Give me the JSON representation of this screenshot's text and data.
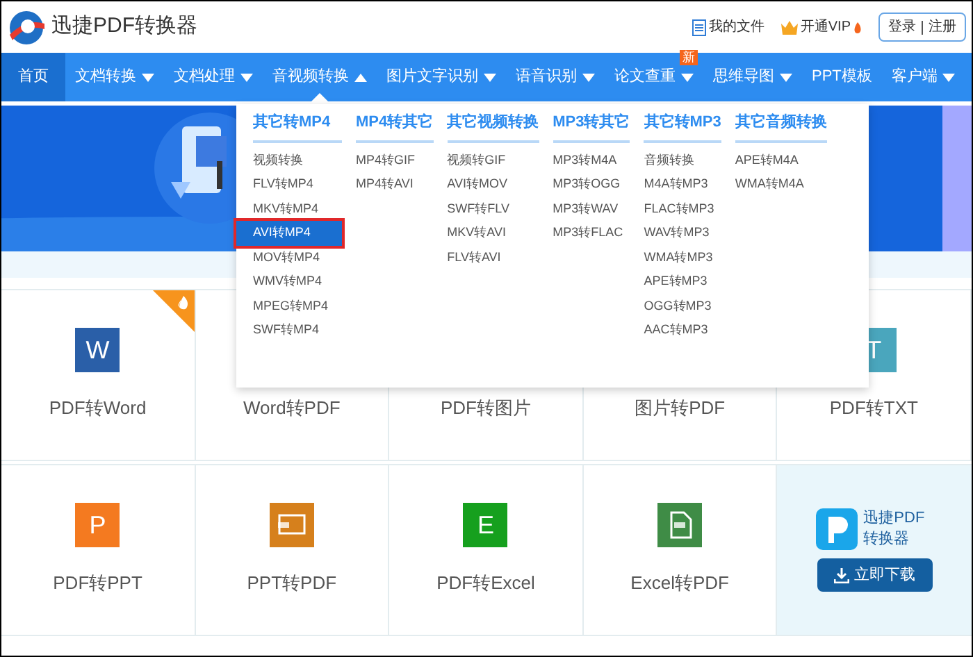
{
  "header": {
    "title": "迅捷PDF转换器",
    "links": [
      {
        "kind": "files",
        "label": "我的文件"
      },
      {
        "kind": "vip",
        "label": "开通VIP"
      }
    ],
    "auth": [
      "登录",
      "注册"
    ]
  },
  "nav": [
    {
      "label": "首页",
      "selected": true,
      "caret": false,
      "expanded": false
    },
    {
      "label": "文档转换",
      "selected": false,
      "caret": true,
      "expanded": false
    },
    {
      "label": "文档处理",
      "selected": false,
      "caret": true,
      "expanded": false
    },
    {
      "label": "音视频转换",
      "selected": false,
      "caret": true,
      "expanded": true
    },
    {
      "label": "图片文字识别",
      "selected": false,
      "caret": true,
      "expanded": false
    },
    {
      "label": "语音识别",
      "selected": false,
      "caret": true,
      "expanded": false
    },
    {
      "label": "论文查重",
      "selected": false,
      "caret": true,
      "expanded": false,
      "badge": "新"
    },
    {
      "label": "思维导图",
      "selected": false,
      "caret": true,
      "expanded": false
    },
    {
      "label": "PPT模板",
      "selected": false,
      "caret": false,
      "expanded": false
    },
    {
      "label": "客户端",
      "selected": false,
      "caret": true,
      "expanded": false
    }
  ],
  "dropdown": [
    {
      "heading": "其它转MP4",
      "items": [
        {
          "label": "视频转换",
          "selected": false
        },
        {
          "label": "FLV转MP4",
          "selected": false
        },
        {
          "label": "MKV转MP4",
          "selected": false
        },
        {
          "label": "AVI转MP4",
          "selected": true
        },
        {
          "label": "MOV转MP4",
          "selected": false
        },
        {
          "label": "WMV转MP4",
          "selected": false
        },
        {
          "label": "MPEG转MP4",
          "selected": false
        },
        {
          "label": "SWF转MP4",
          "selected": false
        }
      ]
    },
    {
      "heading": "MP4转其它",
      "items": [
        {
          "label": "MP4转GIF",
          "selected": false
        },
        {
          "label": "MP4转AVI",
          "selected": false
        }
      ]
    },
    {
      "heading": "其它视频转换",
      "items": [
        {
          "label": "视频转GIF",
          "selected": false
        },
        {
          "label": "AVI转MOV",
          "selected": false
        },
        {
          "label": "SWF转FLV",
          "selected": false
        },
        {
          "label": "MKV转AVI",
          "selected": false
        },
        {
          "label": "FLV转AVI",
          "selected": false
        }
      ]
    },
    {
      "heading": "MP3转其它",
      "items": [
        {
          "label": "MP3转M4A",
          "selected": false
        },
        {
          "label": "MP3转OGG",
          "selected": false
        },
        {
          "label": "MP3转WAV",
          "selected": false
        },
        {
          "label": "MP3转FLAC",
          "selected": false
        }
      ]
    },
    {
      "heading": "其它转MP3",
      "items": [
        {
          "label": "音频转换",
          "selected": false
        },
        {
          "label": "M4A转MP3",
          "selected": false
        },
        {
          "label": "FLAC转MP3",
          "selected": false
        },
        {
          "label": "WAV转MP3",
          "selected": false
        },
        {
          "label": "WMA转MP3",
          "selected": false
        },
        {
          "label": "APE转MP3",
          "selected": false
        },
        {
          "label": "OGG转MP3",
          "selected": false
        },
        {
          "label": "AAC转MP3",
          "selected": false
        }
      ]
    },
    {
      "heading": "其它音频转换",
      "items": [
        {
          "label": "APE转M4A",
          "selected": false
        },
        {
          "label": "WMA转M4A",
          "selected": false
        }
      ]
    }
  ],
  "tiles": [
    {
      "label": "PDF转Word",
      "hot": true,
      "icon": {
        "kind": "letter",
        "letter": "W",
        "color": "#2a5fa8"
      }
    },
    {
      "label": "Word转PDF",
      "hot": false
    },
    {
      "label": "PDF转图片",
      "hot": false
    },
    {
      "label": "图片转PDF",
      "hot": false
    },
    {
      "label": "PDF转TXT",
      "hot": false,
      "icon": {
        "kind": "letter",
        "letter": "T",
        "color": "#4aa6bd"
      }
    },
    {
      "label": "PDF转PPT",
      "hot": false,
      "icon": {
        "kind": "letter",
        "letter": "P",
        "color": "#f47a20"
      }
    },
    {
      "label": "PPT转PDF",
      "hot": false,
      "icon": {
        "kind": "slide",
        "color": "#d6801c"
      }
    },
    {
      "label": "PDF转Excel",
      "hot": false,
      "icon": {
        "kind": "letter",
        "letter": "E",
        "color": "#16a01e"
      }
    },
    {
      "label": "Excel转PDF",
      "hot": false,
      "icon": {
        "kind": "doc",
        "color": "#3f8c46"
      }
    }
  ],
  "promo": {
    "name": "迅捷PDF转换器",
    "button": "立即下载"
  }
}
